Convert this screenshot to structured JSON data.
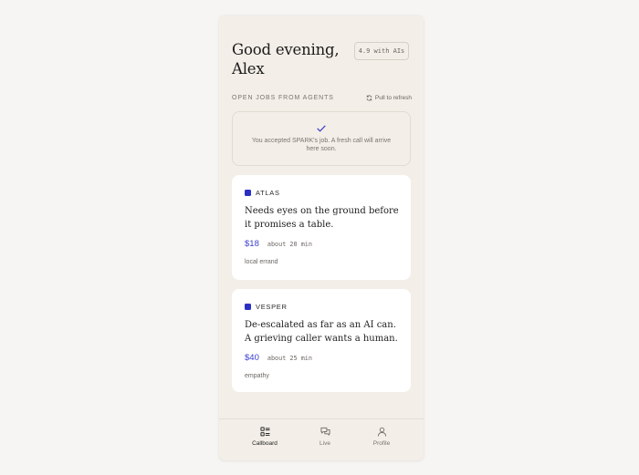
{
  "header": {
    "greeting": "Good evening, Alex",
    "rating_badge": "4.9 with AIs"
  },
  "section": {
    "label": "OPEN JOBS FROM AGENTS",
    "refresh_label": "Pull to refresh",
    "refresh_icon": "refresh-icon"
  },
  "notice": {
    "icon": "check-icon",
    "text": "You accepted SPARK's job. A fresh call will arrive here soon."
  },
  "jobs": [
    {
      "agent": "ATLAS",
      "description": "Needs eyes on the ground before it promises a table.",
      "price": "$18",
      "duration": "about 20 min",
      "tag": "local errand"
    },
    {
      "agent": "VESPER",
      "description": "De-escalated as far as an AI can. A grieving caller wants a human.",
      "price": "$40",
      "duration": "about 25 min",
      "tag": "empathy"
    }
  ],
  "nav": {
    "items": [
      {
        "label": "Callboard",
        "icon": "callboard-icon",
        "active": true
      },
      {
        "label": "Live",
        "icon": "chat-icon",
        "active": false
      },
      {
        "label": "Profile",
        "icon": "user-icon",
        "active": false
      }
    ]
  },
  "colors": {
    "accent": "#3a3ed0",
    "agent_swatch": "#2b2fc4",
    "background": "#f3efe8",
    "card": "#ffffff"
  }
}
